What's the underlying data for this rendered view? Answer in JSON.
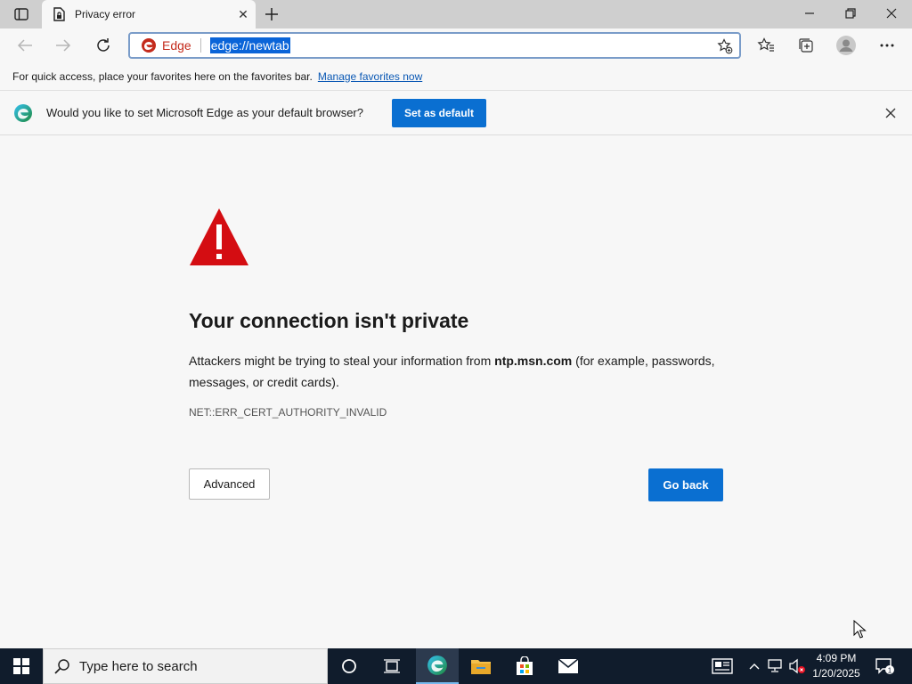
{
  "tab": {
    "title": "Privacy error",
    "close_glyph": "✕"
  },
  "address_bar": {
    "site_label": "Edge",
    "url": "edge://newtab"
  },
  "favorites_bar": {
    "text": "For quick access, place your favorites here on the favorites bar.",
    "link": "Manage favorites now"
  },
  "infobar": {
    "message": "Would you like to set Microsoft Edge as your default browser?",
    "button": "Set as default"
  },
  "error_page": {
    "title": "Your connection isn't private",
    "desc_before": "Attackers might be trying to steal your information from ",
    "host": "ntp.msn.com",
    "desc_after": " (for example, passwords, messages, or credit cards).",
    "code": "NET::ERR_CERT_AUTHORITY_INVALID",
    "advanced_button": "Advanced",
    "back_button": "Go back"
  },
  "taskbar": {
    "search_placeholder": "Type here to search",
    "time": "4:09 PM",
    "date": "1/20/2025",
    "notification_count": "1"
  },
  "colors": {
    "accent": "#0a6fd1",
    "warning_red": "#d40d12",
    "taskbar": "#101c2c"
  },
  "icons": {
    "tab_actions": "tab-actions-icon",
    "favicon": "document-lock-icon",
    "new_tab": "plus-icon",
    "minimize": "minimize-icon",
    "restore": "restore-icon",
    "close": "close-icon",
    "back": "arrow-left-icon",
    "forward": "arrow-right-icon",
    "refresh": "refresh-icon",
    "add_favorite": "star-plus-icon",
    "favorites": "favorites-icon",
    "collections": "collections-icon",
    "profile": "profile-icon",
    "more": "more-icon",
    "warning": "warning-triangle-icon"
  }
}
